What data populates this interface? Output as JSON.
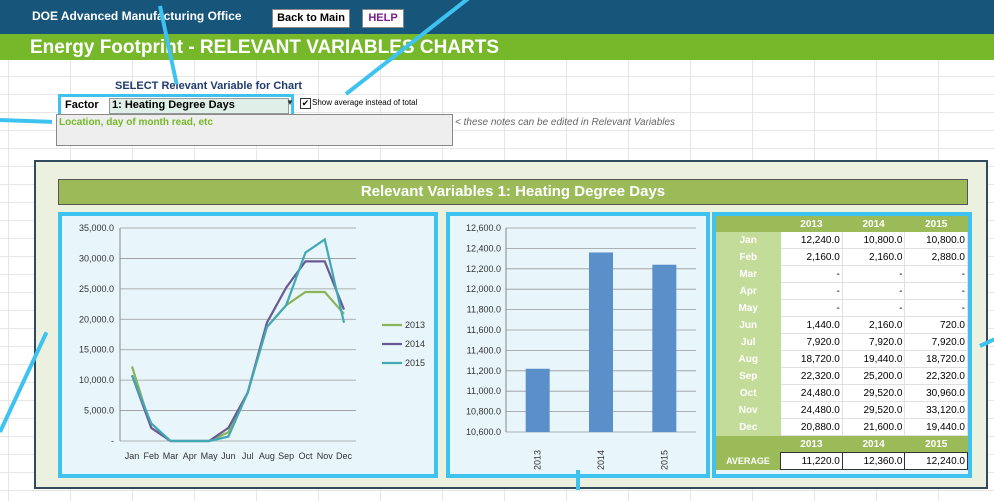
{
  "app": {
    "name": "DOE Advanced Manufacturing Office",
    "back_label": "Back to Main",
    "help_label": "HELP"
  },
  "page": {
    "title": "Energy Footprint - RELEVANT VARIABLES CHARTS"
  },
  "selector": {
    "heading": "SELECT Relevant Variable for Chart",
    "factor_label": "Factor",
    "factor_value": "1: Heating Degree Days",
    "checkbox_checked": true,
    "checkbox_label": "Show average instead of total",
    "notes_text": "Location, day of month read, etc",
    "notes_hint": "< these notes can be edited in Relevant Variables"
  },
  "panel": {
    "title": "Relevant Variables 1:  Heating Degree Days"
  },
  "colors": {
    "s2013": "#8cb356",
    "s2014": "#6a5a93",
    "s2015": "#41a8b4",
    "bar": "#5b8fc9",
    "accent": "#3ec3f0"
  },
  "chart_data": [
    {
      "type": "line",
      "categories": [
        "Jan",
        "Feb",
        "Mar",
        "Apr",
        "May",
        "Jun",
        "Jul",
        "Aug",
        "Sep",
        "Oct",
        "Nov",
        "Dec"
      ],
      "series": [
        {
          "name": "2013",
          "values": [
            12240,
            2160,
            0,
            0,
            0,
            1440,
            7920,
            18720,
            22320,
            24480,
            24480,
            20880
          ]
        },
        {
          "name": "2014",
          "values": [
            10800,
            2160,
            0,
            0,
            0,
            2160,
            7920,
            19440,
            25200,
            29520,
            29520,
            21600
          ]
        },
        {
          "name": "2015",
          "values": [
            10800,
            2880,
            0,
            0,
            0,
            720,
            7920,
            18720,
            22320,
            30960,
            33120,
            19440
          ]
        }
      ],
      "ylim": [
        0,
        35000
      ],
      "yticks": [
        "-",
        "5,000.0",
        "10,000.0",
        "15,000.0",
        "20,000.0",
        "25,000.0",
        "30,000.0",
        "35,000.0"
      ],
      "legend": "right"
    },
    {
      "type": "bar",
      "categories": [
        "2013",
        "2014",
        "2015"
      ],
      "values": [
        11220,
        12360,
        12240
      ],
      "ylim": [
        10600,
        12600
      ],
      "yticks": [
        "10,600.0",
        "10,800.0",
        "11,000.0",
        "11,200.0",
        "11,400.0",
        "11,600.0",
        "11,800.0",
        "12,000.0",
        "12,200.0",
        "12,400.0",
        "12,600.0"
      ]
    },
    {
      "type": "table",
      "columns": [
        "2013",
        "2014",
        "2015"
      ],
      "rows": [
        {
          "month": "Jan",
          "values": [
            "12,240.0",
            "10,800.0",
            "10,800.0"
          ]
        },
        {
          "month": "Feb",
          "values": [
            "2,160.0",
            "2,160.0",
            "2,880.0"
          ]
        },
        {
          "month": "Mar",
          "values": [
            "-",
            "-",
            "-"
          ]
        },
        {
          "month": "Apr",
          "values": [
            "-",
            "-",
            "-"
          ]
        },
        {
          "month": "May",
          "values": [
            "-",
            "-",
            "-"
          ]
        },
        {
          "month": "Jun",
          "values": [
            "1,440.0",
            "2,160.0",
            "720.0"
          ]
        },
        {
          "month": "Jul",
          "values": [
            "7,920.0",
            "7,920.0",
            "7,920.0"
          ]
        },
        {
          "month": "Aug",
          "values": [
            "18,720.0",
            "19,440.0",
            "18,720.0"
          ]
        },
        {
          "month": "Sep",
          "values": [
            "22,320.0",
            "25,200.0",
            "22,320.0"
          ]
        },
        {
          "month": "Oct",
          "values": [
            "24,480.0",
            "29,520.0",
            "30,960.0"
          ]
        },
        {
          "month": "Nov",
          "values": [
            "24,480.0",
            "29,520.0",
            "33,120.0"
          ]
        },
        {
          "month": "Dec",
          "values": [
            "20,880.0",
            "21,600.0",
            "19,440.0"
          ]
        }
      ],
      "average_label": "AVERAGE",
      "average": [
        "11,220.0",
        "12,360.0",
        "12,240.0"
      ]
    }
  ]
}
